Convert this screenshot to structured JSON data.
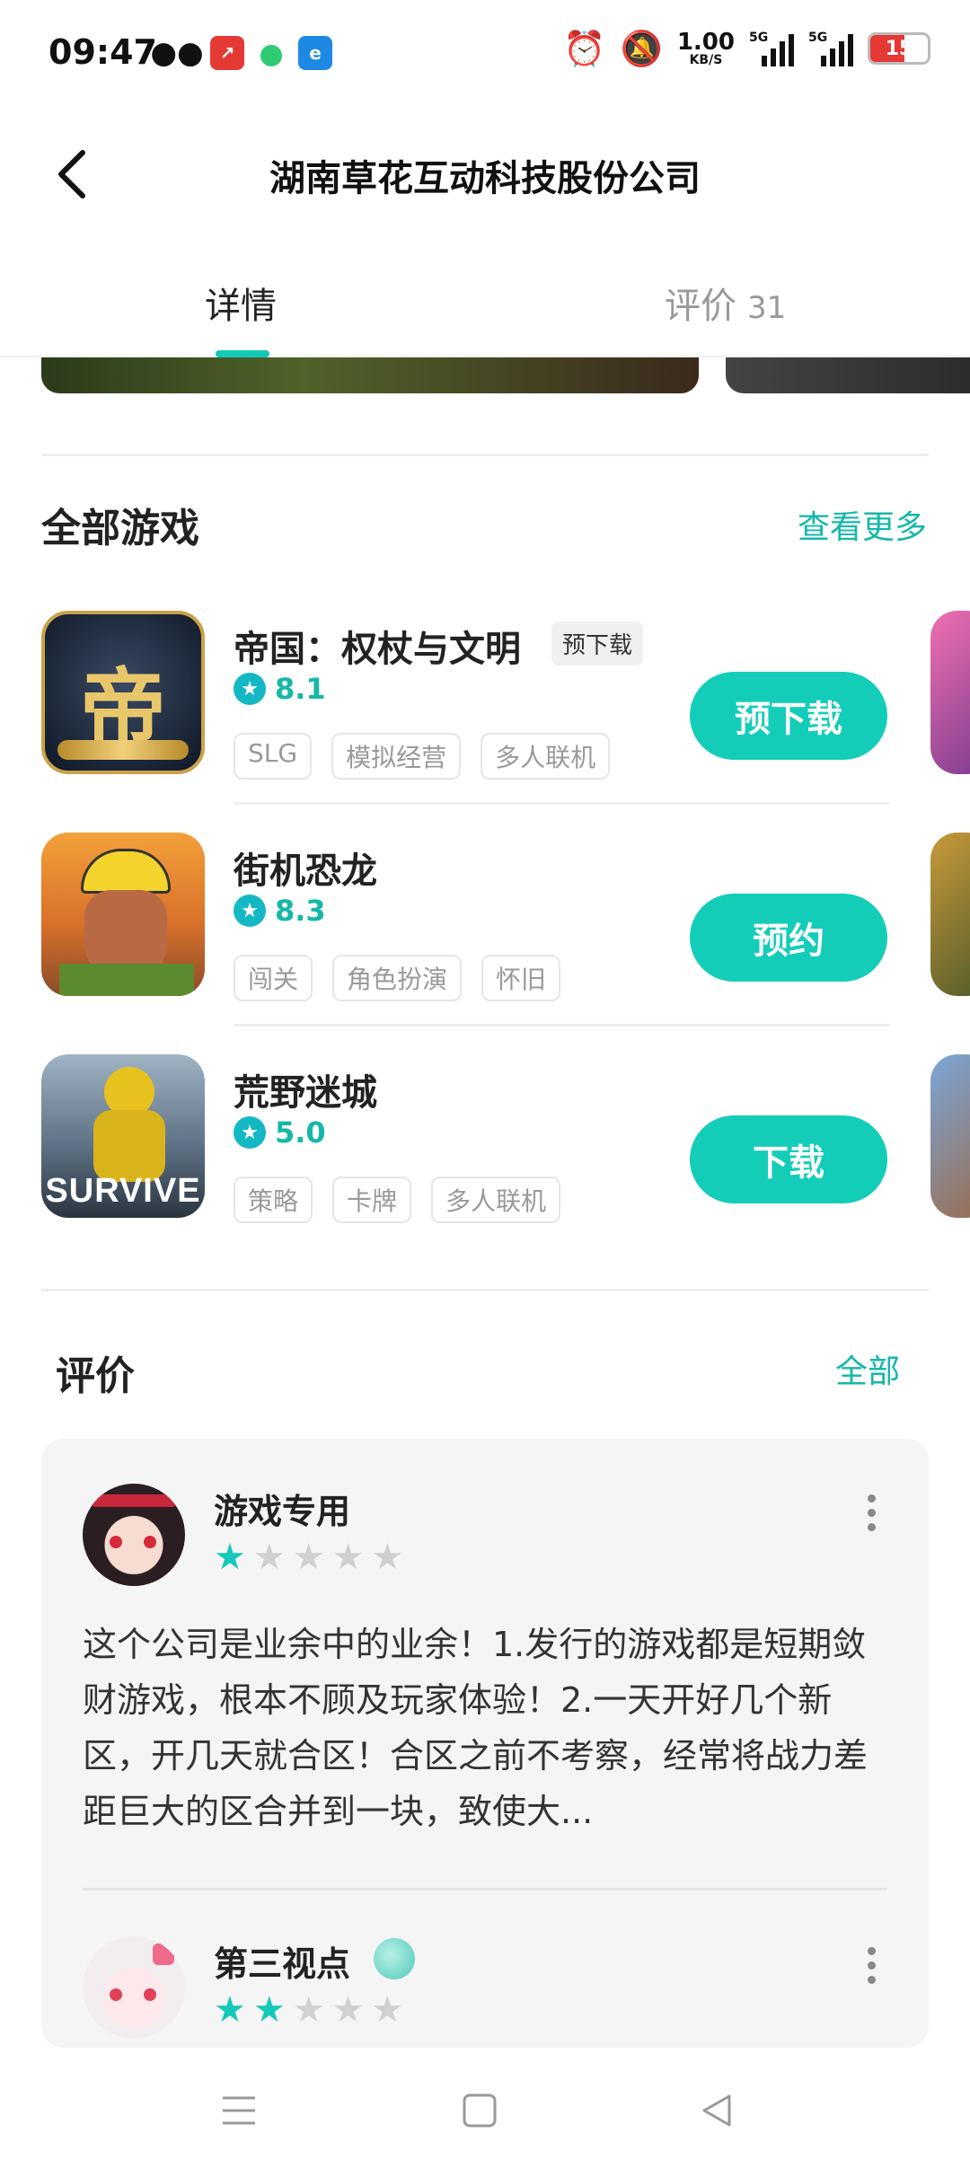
{
  "status_bar": {
    "time": "09:47",
    "speed_value": "1.00",
    "speed_unit": "KB/S",
    "network_1": "5G",
    "network_2": "5G",
    "battery_level": "15",
    "icons": [
      "wechat-icon",
      "stock-app-icon",
      "green-dot-icon",
      "browser-app-icon",
      "alarm-icon",
      "mute-icon"
    ]
  },
  "header": {
    "title": "湖南草花互动科技股份公司"
  },
  "tabs": [
    {
      "label": "详情",
      "count": ""
    },
    {
      "label": "评价",
      "count": "31"
    }
  ],
  "all_games": {
    "title": "全部游戏",
    "more": "查看更多",
    "games": [
      {
        "name": "帝国：权杖与文明",
        "badge": "预下载",
        "rating": "8.1",
        "tags": [
          "SLG",
          "模拟经营",
          "多人联机"
        ],
        "action": "预下载"
      },
      {
        "name": "街机恐龙",
        "badge": "",
        "rating": "8.3",
        "tags": [
          "闯关",
          "角色扮演",
          "怀旧"
        ],
        "action": "预约"
      },
      {
        "name": "荒野迷城",
        "badge": "",
        "rating": "5.0",
        "tags": [
          "策略",
          "卡牌",
          "多人联机"
        ],
        "action": "下载",
        "icon_text": "SURVIVE"
      }
    ],
    "icon_1_text": "帝"
  },
  "reviews": {
    "title": "评价",
    "more": "全部",
    "items": [
      {
        "user": "游戏专用",
        "stars": 1,
        "text": "这个公司是业余中的业余！1.发行的游戏都是短期敛财游戏，根本不顾及玩家体验！2.一天开好几个新区，开几天就合区！合区之前不考察，经常将战力差距巨大的区合并到一块，致使大..."
      },
      {
        "user": "第三视点",
        "stars": 2,
        "text": ""
      }
    ]
  },
  "colors": {
    "accent": "#14cdb9",
    "accent_text": "#14b8a9"
  }
}
